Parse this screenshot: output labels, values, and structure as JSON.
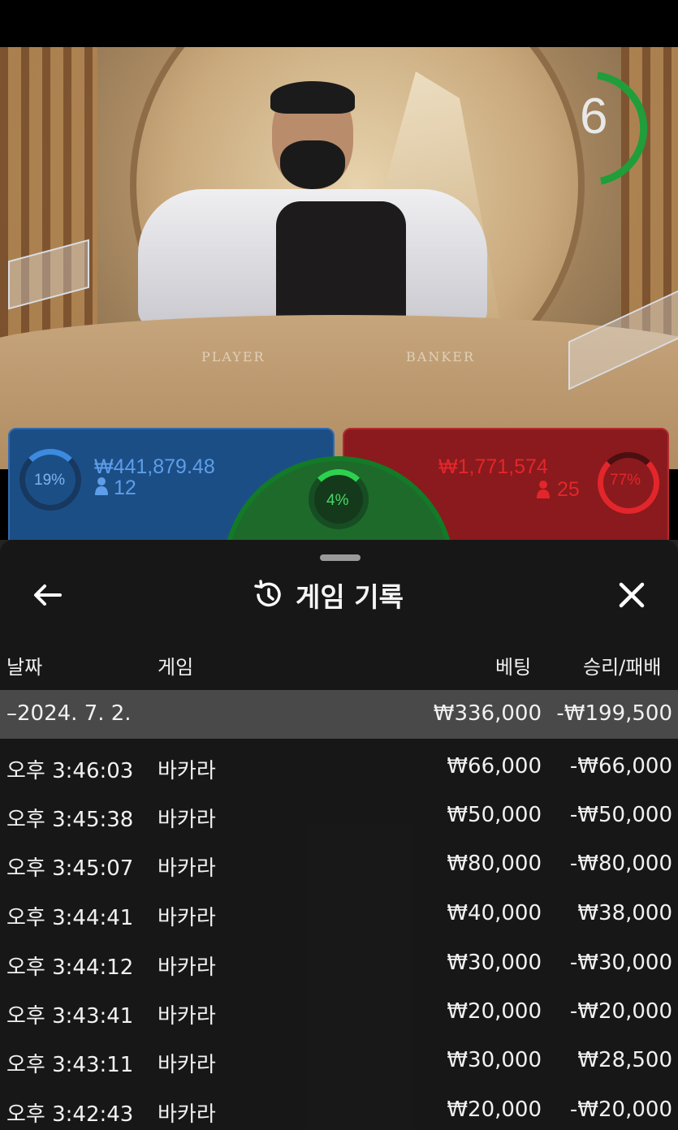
{
  "video": {
    "table_label_player": "PLAYER",
    "table_label_banker": "BANKER",
    "countdown": "6"
  },
  "bets": {
    "player": {
      "percent": "19%",
      "amount": "₩441,879.48",
      "players": "12",
      "color": "#1c4e86"
    },
    "banker": {
      "percent": "77%",
      "amount": "₩1,771,574",
      "players": "25",
      "color": "#8a1a1d"
    },
    "tie": {
      "percent": "4%",
      "color": "#1e6a2b"
    }
  },
  "history": {
    "title": "게임 기록",
    "back_icon": "arrow-left-icon",
    "history_icon": "history-clock-icon",
    "close_icon": "close-icon",
    "columns": {
      "date": "날짜",
      "game": "게임",
      "bet": "베팅",
      "result": "승리/패배"
    },
    "date_group": {
      "label": "–2024. 7. 2.",
      "bet": "₩336,000",
      "result": "-₩199,500"
    },
    "rows": [
      {
        "time": "오후 3:46:03",
        "game": "바카라",
        "bet": "₩66,000",
        "result": "-₩66,000"
      },
      {
        "time": "오후 3:45:38",
        "game": "바카라",
        "bet": "₩50,000",
        "result": "-₩50,000"
      },
      {
        "time": "오후 3:45:07",
        "game": "바카라",
        "bet": "₩80,000",
        "result": "-₩80,000"
      },
      {
        "time": "오후 3:44:41",
        "game": "바카라",
        "bet": "₩40,000",
        "result": "₩38,000"
      },
      {
        "time": "오후 3:44:12",
        "game": "바카라",
        "bet": "₩30,000",
        "result": "-₩30,000"
      },
      {
        "time": "오후 3:43:41",
        "game": "바카라",
        "bet": "₩20,000",
        "result": "-₩20,000"
      },
      {
        "time": "오후 3:43:11",
        "game": "바카라",
        "bet": "₩30,000",
        "result": "₩28,500"
      },
      {
        "time": "오후 3:42:43",
        "game": "바카라",
        "bet": "₩20,000",
        "result": "-₩20,000"
      }
    ]
  }
}
